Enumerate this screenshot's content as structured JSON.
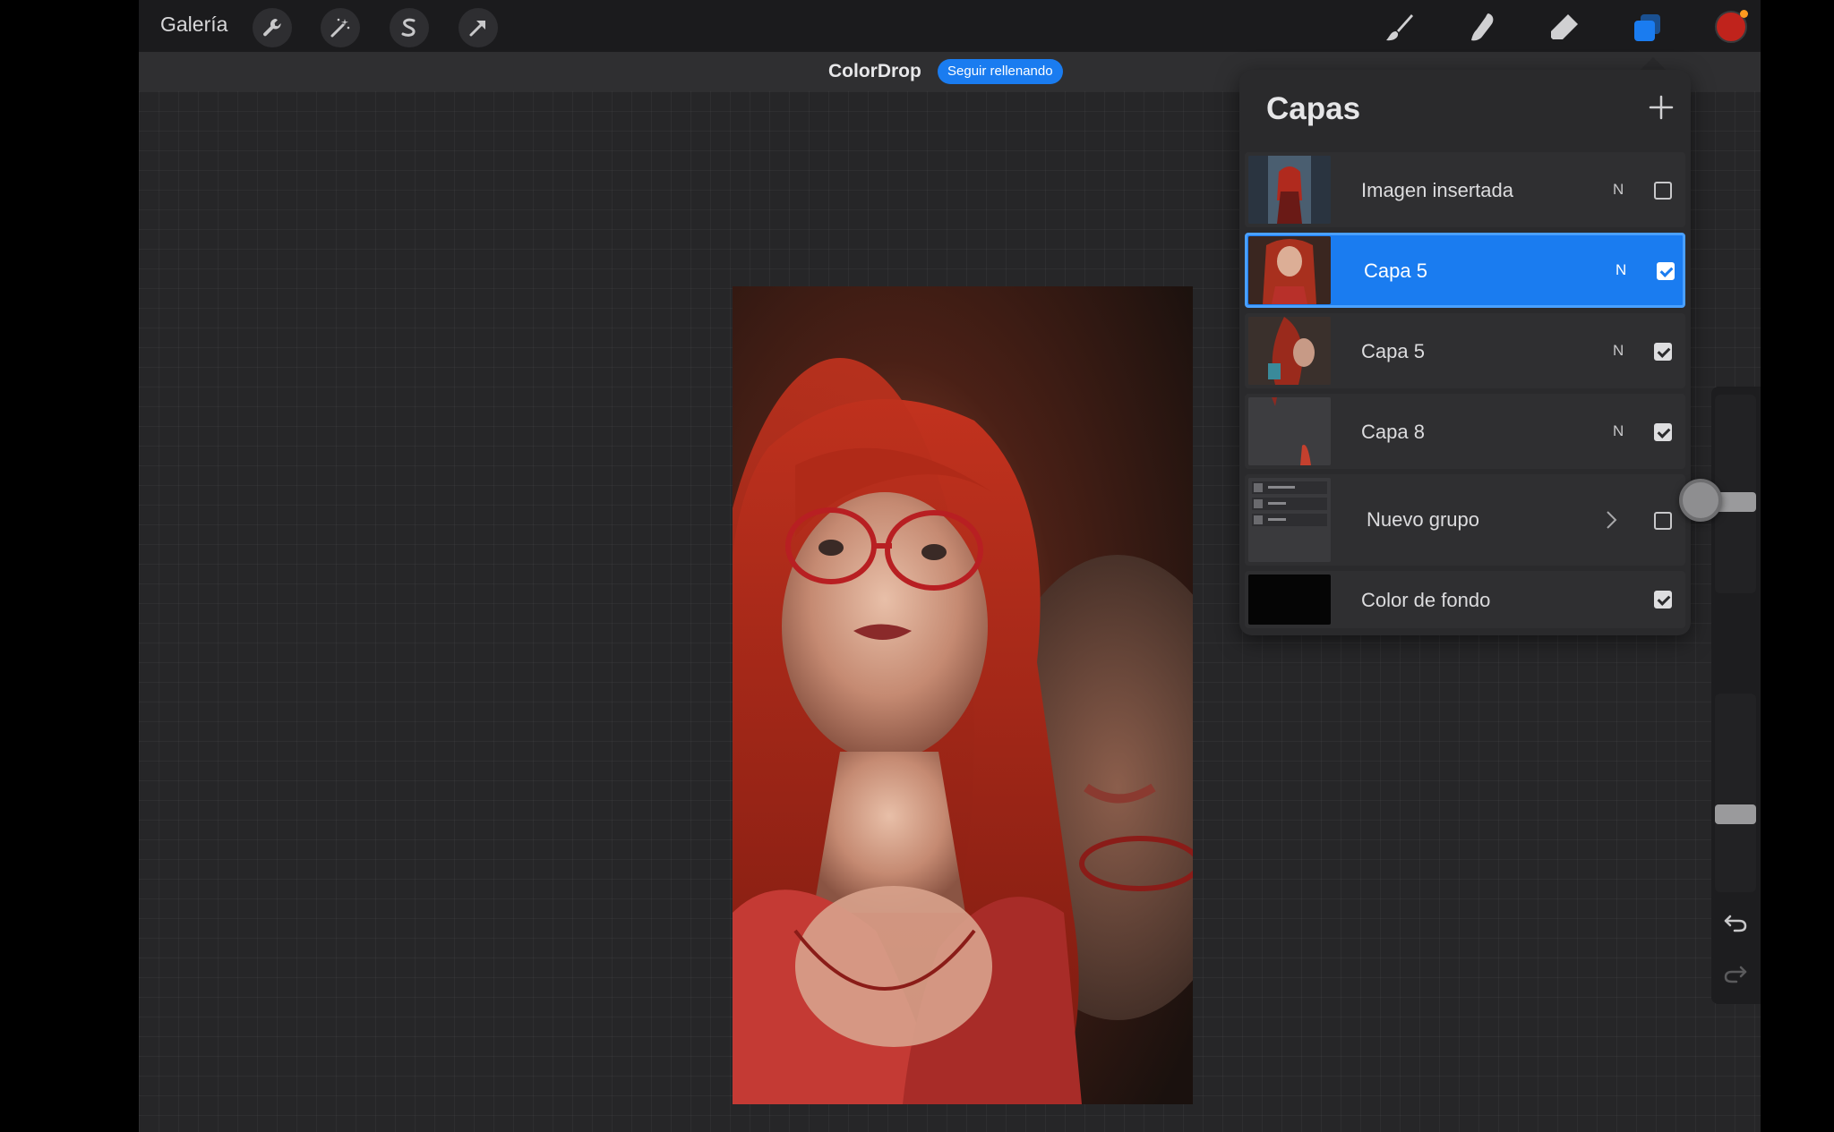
{
  "toolbar": {
    "gallery_label": "Galería",
    "left_tools": [
      "wrench-icon",
      "magic-wand-icon",
      "selection-s-icon",
      "transform-arrow-icon"
    ],
    "right_tools": [
      "brush-icon",
      "smudge-icon",
      "eraser-icon",
      "layers-icon"
    ],
    "active_color": "#c0231c"
  },
  "colordrop": {
    "title": "ColorDrop",
    "action_label": "Seguir rellenando"
  },
  "layers_panel": {
    "title": "Capas",
    "layers": [
      {
        "name": "Imagen insertada",
        "mode": "N",
        "visible": false,
        "selected": false
      },
      {
        "name": "Capa 5",
        "mode": "N",
        "visible": true,
        "selected": true
      },
      {
        "name": "Capa 5",
        "mode": "N",
        "visible": true,
        "selected": false
      },
      {
        "name": "Capa 8",
        "mode": "N",
        "visible": true,
        "selected": false
      },
      {
        "name": "Nuevo grupo",
        "mode": "",
        "visible": false,
        "selected": false,
        "is_group": true
      },
      {
        "name": "Color de fondo",
        "mode": "",
        "visible": true,
        "selected": false
      }
    ]
  },
  "accent_color": "#1a7cf0"
}
